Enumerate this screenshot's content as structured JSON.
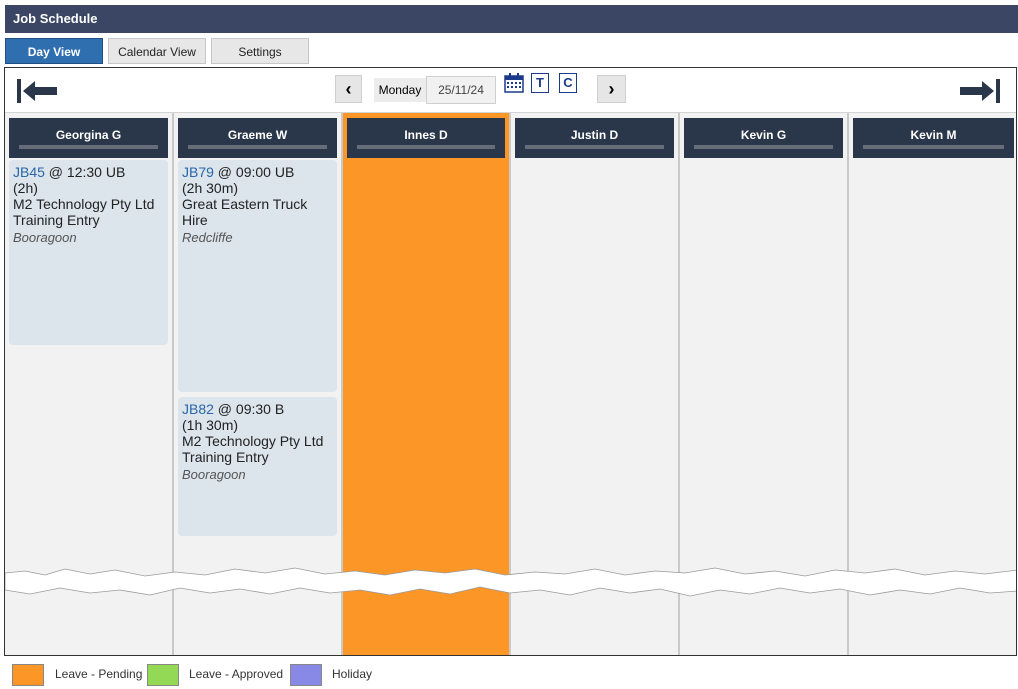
{
  "window": {
    "title": "Job Schedule"
  },
  "tabs": [
    {
      "label": "Day View",
      "active": true
    },
    {
      "label": "Calendar View",
      "active": false
    },
    {
      "label": "Settings",
      "active": false
    }
  ],
  "nav": {
    "prev_symbol": "‹",
    "next_symbol": "›",
    "day_label": "Monday",
    "date_value": "25/11/24",
    "calendar_icon": "calendar-icon",
    "today_icon_letter": "T",
    "custom_icon_letter": "C",
    "first_icon": "arrow-to-start-icon",
    "last_icon": "arrow-to-end-icon"
  },
  "staff": [
    {
      "name": "Georgina G",
      "leave": false,
      "jobs": [
        {
          "ref": "JB45",
          "time": " @ 12:30 UB",
          "duration": "(2h)",
          "client": "M2 Technology Pty Ltd",
          "type": "Training Entry",
          "location": "Booragoon"
        }
      ]
    },
    {
      "name": "Graeme W",
      "leave": false,
      "jobs": [
        {
          "ref": "JB79",
          "time": " @ 09:00 UB",
          "duration": "(2h 30m)",
          "client": "Great Eastern Truck Hire",
          "type": "",
          "location": "Redcliffe"
        },
        {
          "ref": "JB82",
          "time": " @ 09:30 B",
          "duration": "(1h 30m)",
          "client": "M2 Technology Pty Ltd",
          "type": "Training Entry",
          "location": "Booragoon"
        }
      ]
    },
    {
      "name": "Innes D",
      "leave": true,
      "jobs": []
    },
    {
      "name": "Justin D",
      "leave": false,
      "jobs": []
    },
    {
      "name": "Kevin G",
      "leave": false,
      "jobs": []
    },
    {
      "name": "Kevin M",
      "leave": false,
      "jobs": []
    }
  ],
  "legend": [
    {
      "label": "Leave - Pending",
      "color": "#fb9627"
    },
    {
      "label": "Leave - Approved",
      "color": "#93d955"
    },
    {
      "label": "Holiday",
      "color": "#8888e6"
    }
  ],
  "colors": {
    "header": "#3a4664",
    "accent": "#2f6fb0",
    "leave_pending": "#fb9627"
  }
}
